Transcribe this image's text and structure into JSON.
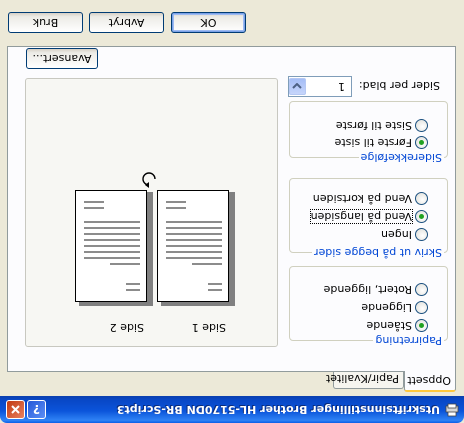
{
  "window": {
    "title": "Utskriftsinnstillinger Brother HL-5170DN BR-Script3"
  },
  "tabs": [
    {
      "label": "Oppsett",
      "selected": true
    },
    {
      "label": "Papir/Kvalitet",
      "selected": false
    }
  ],
  "orientation": {
    "label": "Papirretning",
    "options": [
      {
        "label": "Stående",
        "checked": true
      },
      {
        "label": "Liggende",
        "checked": false
      },
      {
        "label": "Rotert, liggende",
        "checked": false
      }
    ]
  },
  "duplex": {
    "label": "Skriv ut på begge sider",
    "options": [
      {
        "label": "Ingen",
        "checked": false
      },
      {
        "label": "Vend på langsiden",
        "checked": true
      },
      {
        "label": "Vend på kortsiden",
        "checked": false
      }
    ]
  },
  "page_order": {
    "label": "Siderekkefølge",
    "options": [
      {
        "label": "Første til siste",
        "checked": true
      },
      {
        "label": "Siste til første",
        "checked": false
      }
    ]
  },
  "pages_per_sheet": {
    "label": "Sider per blad:",
    "value": "1"
  },
  "preview": {
    "page1_label": "Side 1",
    "page2_label": "Side 2"
  },
  "buttons": {
    "advanced": "Avansert...",
    "ok": "OK",
    "cancel": "Avbryt",
    "apply": "Bruk"
  },
  "colors": {
    "titlebar": "#0b54da",
    "group_label": "#0046d5",
    "radio_dot": "#21a121",
    "dialog_bg": "#ece9d8"
  }
}
